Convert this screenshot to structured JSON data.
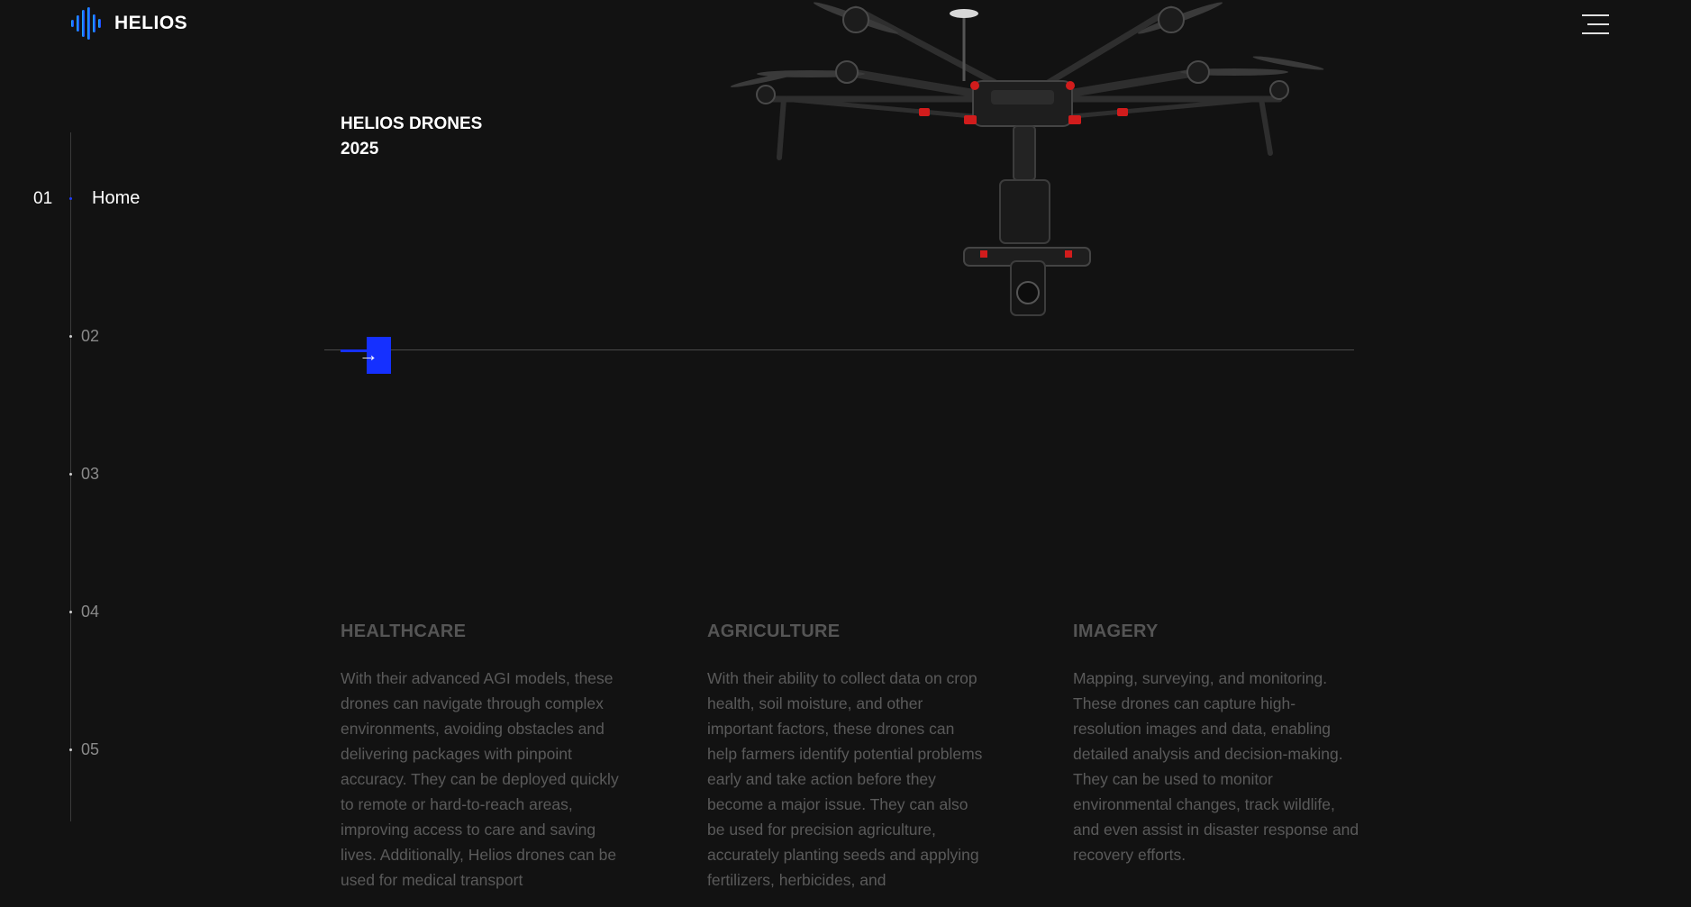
{
  "brand": {
    "name": "HELIOS",
    "accent": "#1530ff",
    "logo_gradient": [
      "#1fb6ff",
      "#1f3bff"
    ]
  },
  "nav": {
    "menu_icon": "hamburger-icon"
  },
  "sections": {
    "active": {
      "number": "01",
      "label": "Home"
    },
    "items": [
      {
        "number": "02"
      },
      {
        "number": "03"
      },
      {
        "number": "04"
      },
      {
        "number": "05"
      }
    ]
  },
  "hero": {
    "title_line1": "HELIOS DRONES",
    "title_line2": "2025",
    "next_button_icon": "arrow-right-icon",
    "image": "hexacopter-drone"
  },
  "features": [
    {
      "title": "HEALTHCARE",
      "text": "With their advanced AGI models, these drones can navigate through complex environments, avoiding obstacles and delivering packages with pinpoint accuracy. They can be deployed quickly to remote or hard-to-reach areas, improving access to care and saving lives. Additionally, Helios drones can be used for medical transport"
    },
    {
      "title": "AGRICULTURE",
      "text": "With their ability to collect data on crop health, soil moisture, and other important factors, these drones can help farmers identify potential problems early and take action before they become a major issue. They can also be used for precision agriculture, accurately planting seeds and applying fertilizers, herbicides, and"
    },
    {
      "title": "IMAGERY",
      "text": "Mapping, surveying, and monitoring. These drones can capture high-resolution images and data, enabling detailed analysis and decision-making. They can be used to monitor environmental changes, track wildlife, and even assist in disaster response and recovery efforts."
    }
  ]
}
